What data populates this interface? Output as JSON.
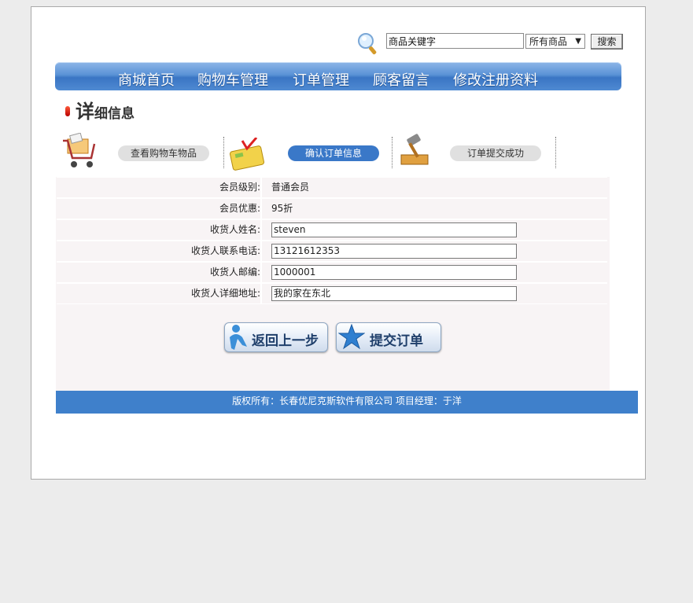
{
  "search": {
    "keyword_value": "商品关键字",
    "category_selected": "所有商品",
    "button_label": "搜索"
  },
  "nav": {
    "items": [
      "商城首页",
      "购物车管理",
      "订单管理",
      "顾客留言",
      "修改注册资料"
    ]
  },
  "page_title": {
    "first_char": "详",
    "rest": "细信息"
  },
  "steps": [
    {
      "label": "查看购物车物品",
      "icon": "shopping-cart-icon"
    },
    {
      "label": "确认订单信息",
      "icon": "calculator-icon"
    },
    {
      "label": "订单提交成功",
      "icon": "gavel-icon"
    }
  ],
  "form": {
    "member_level": {
      "label": "会员级别:",
      "value": "普通会员"
    },
    "member_discount": {
      "label": "会员优惠:",
      "value": "95折"
    },
    "receiver_name": {
      "label": "收货人姓名:",
      "value": "steven"
    },
    "receiver_phone": {
      "label": "收货人联系电话:",
      "value": "13121612353"
    },
    "receiver_postcode": {
      "label": "收货人邮编:",
      "value": "1000001"
    },
    "receiver_address": {
      "label": "收货人详细地址:",
      "value": "我的家在东北"
    }
  },
  "actions": {
    "back_label": "返回上一步",
    "submit_label": "提交订单"
  },
  "footer": {
    "text": "版权所有：长春优尼克斯软件有限公司 项目经理：于洋"
  },
  "colors": {
    "nav_blue": "#4f8ad2",
    "active_pill": "#3a78c8",
    "footer_blue": "#3f80cb",
    "form_bg": "#f8f4f5"
  }
}
